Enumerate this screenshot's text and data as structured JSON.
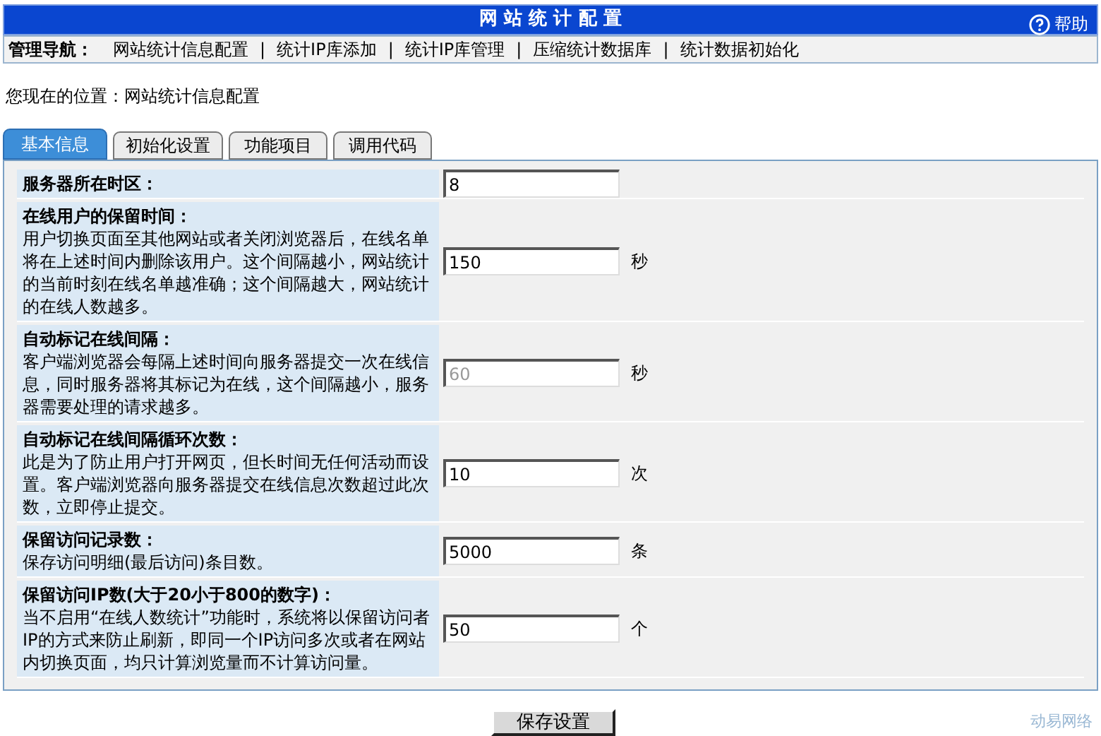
{
  "header": {
    "title": "网 站 统 计 配 置",
    "help": "帮助"
  },
  "nav": {
    "label": "管理导航：",
    "links": [
      {
        "label": "网站统计信息配置"
      },
      {
        "label": "统计IP库添加"
      },
      {
        "label": "统计IP库管理"
      },
      {
        "label": "压缩统计数据库"
      },
      {
        "label": "统计数据初始化"
      }
    ],
    "separator": "|"
  },
  "breadcrumb": "您现在的位置：网站统计信息配置",
  "tabs": [
    {
      "label": "基本信息",
      "selected": true
    },
    {
      "label": "初始化设置",
      "selected": false
    },
    {
      "label": "功能项目",
      "selected": false
    },
    {
      "label": "调用代码",
      "selected": false
    }
  ],
  "settings": [
    {
      "title": "服务器所在时区：",
      "value": "8",
      "disabled": false
    },
    {
      "title": "在线用户的保留时间：",
      "description": "用户切换页面至其他网站或者关闭浏览器后，在线名单将在上述时间内删除该用户。这个间隔越小，网站统计的当前时刻在线名单越准确；这个间隔越大，网站统计的在线人数越多。",
      "value": "150",
      "unit": "秒",
      "disabled": false
    },
    {
      "title": "自动标记在线间隔：",
      "description": "客户端浏览器会每隔上述时间向服务器提交一次在线信息，同时服务器将其标记为在线，这个间隔越小，服务器需要处理的请求越多。",
      "value": "60",
      "unit": "秒",
      "disabled": true
    },
    {
      "title": "自动标记在线间隔循环次数：",
      "description": "此是为了防止用户打开网页，但长时间无任何活动而设置。客户端浏览器向服务器提交在线信息次数超过此次数，立即停止提交。",
      "value": "10",
      "unit": "次",
      "disabled": false
    },
    {
      "title": "保留访问记录数：",
      "description": "保存访问明细(最后访问)条目数。",
      "value": "5000",
      "unit": "条",
      "disabled": false
    },
    {
      "title": "保留访问IP数(大于20小于800的数字)：",
      "description": "当不启用“在线人数统计”功能时，系统将以保留访问者IP的方式来防止刷新，即同一个IP访问多次或者在网站内切换页面，均只计算浏览量而不计算访问量。",
      "value": "50",
      "unit": "个",
      "disabled": false
    }
  ],
  "save_button": "保存设置",
  "footer": "动易网络"
}
